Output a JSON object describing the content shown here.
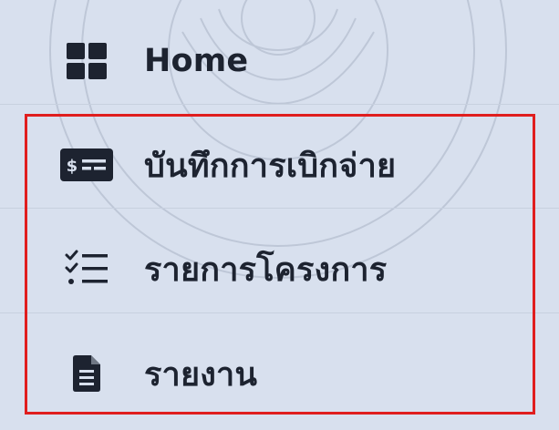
{
  "sidebar": {
    "items": [
      {
        "label": "Home",
        "icon": "grid-icon"
      },
      {
        "label": "บันทึกการเบิกจ่าย",
        "icon": "money-card-icon"
      },
      {
        "label": "รายการโครงการ",
        "icon": "checklist-icon"
      },
      {
        "label": "รายงาน",
        "icon": "document-icon"
      }
    ],
    "selection_outline_color": "#e01e1e",
    "text_color": "#1d2330",
    "background_color": "#d8e0ee"
  }
}
